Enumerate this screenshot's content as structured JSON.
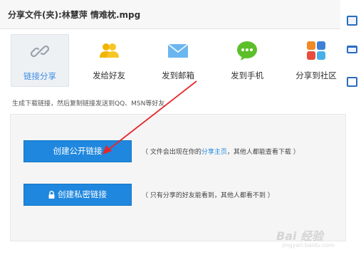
{
  "title": "分享文件(夹):林慧萍 情难枕.mpg",
  "tabs": [
    {
      "label": "链接分享",
      "icon": "link-icon"
    },
    {
      "label": "发给好友",
      "icon": "friends-icon"
    },
    {
      "label": "发到邮箱",
      "icon": "mail-icon"
    },
    {
      "label": "发到手机",
      "icon": "chat-bubble-icon"
    },
    {
      "label": "分享到社区",
      "icon": "community-apps-icon"
    }
  ],
  "hint": "生成下载链接，然后复制链接发送到QQ、MSN等好友",
  "public_button": {
    "label": "创建公开链接"
  },
  "public_desc": {
    "prefix": "（ 文件会出现在你的",
    "link": "分享主页",
    "suffix": "，其他人都能查看下载 ）"
  },
  "private_button": {
    "label": "创建私密链接",
    "icon": "lock-icon"
  },
  "private_desc": "（ 只有分享的好友能看到，其他人都看不到 ）",
  "watermark": {
    "main": "Bai 经验",
    "sub": "jingyan.baidu.com"
  },
  "colors": {
    "accent": "#1f87de",
    "arrow": "#e5262b"
  }
}
